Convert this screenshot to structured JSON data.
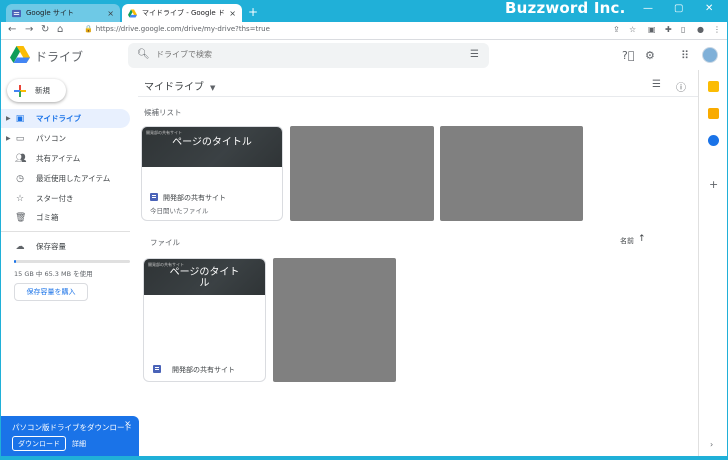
{
  "browser": {
    "tabs": [
      {
        "title": "Google サイト",
        "active": false,
        "favicon": "google-sites-icon"
      },
      {
        "title": "マイドライブ - Google ドライブ",
        "active": true,
        "favicon": "google-drive-icon"
      }
    ],
    "new_tab": "+",
    "close_tab": "×",
    "url": "https://drive.google.com/drive/my-drive?ths=true",
    "watermark": "Buzzword Inc.",
    "window_controls": {
      "minimize": "—",
      "maximize": "▢",
      "close": "✕"
    },
    "accent": "#20b0d8"
  },
  "header": {
    "product": "ドライブ",
    "search_placeholder": "ドライブで検索",
    "icons": [
      "search-icon",
      "tune-icon",
      "help-icon",
      "settings-icon",
      "apps-icon",
      "avatar"
    ]
  },
  "sidebar": {
    "new_label": "新規",
    "items": [
      {
        "label": "マイドライブ",
        "icon": "drive-icon",
        "selected": true,
        "has_arrow": true
      },
      {
        "label": "パソコン",
        "icon": "computer-icon",
        "selected": false,
        "has_arrow": true
      },
      {
        "label": "共有アイテム",
        "icon": "shared-icon",
        "selected": false,
        "has_arrow": false
      },
      {
        "label": "最近使用したアイテム",
        "icon": "clock-icon",
        "selected": false,
        "has_arrow": false
      },
      {
        "label": "スター付き",
        "icon": "star-icon",
        "selected": false,
        "has_arrow": false
      },
      {
        "label": "ゴミ箱",
        "icon": "trash-icon",
        "selected": false,
        "has_arrow": false
      }
    ],
    "storage_label": "保存容量",
    "storage_text": "15 GB 中 65.3 MB を使用",
    "storage_fraction": 0.004,
    "buy_storage": "保存容量を購入"
  },
  "promo": {
    "title": "パソコン版ドライブをダウンロード",
    "download": "ダウンロード",
    "details": "詳細",
    "close": "×"
  },
  "main": {
    "title": "マイドライブ",
    "suggested_label": "候補リスト",
    "files_label": "ファイル",
    "sort_label": "名前",
    "sort_arrow": "↑",
    "suggested_card": {
      "thumb_mini": "開発部の共有サイト",
      "thumb_title": "ページのタイトル",
      "name": "開発部の共有サイト",
      "sub": "今日開いたファイル"
    },
    "file_card": {
      "thumb_mini": "開発部の共有サイト",
      "thumb_title": "ページのタイトル",
      "name": "開発部の共有サイト"
    }
  }
}
